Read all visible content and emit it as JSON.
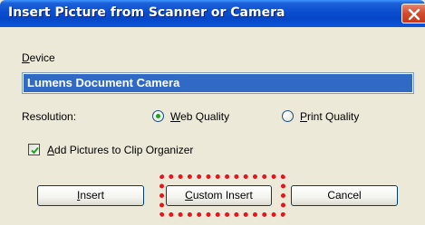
{
  "dialog": {
    "title": "Insert Picture from Scanner or Camera",
    "close_icon": "close-x-icon"
  },
  "device": {
    "label_first": "D",
    "label_rest": "evice",
    "selected": "Lumens Document Camera"
  },
  "resolution": {
    "label": "Resolution:",
    "options": [
      {
        "accel": "W",
        "rest": "eb Quality",
        "selected": true
      },
      {
        "accel": "P",
        "rest": "rint Quality",
        "selected": false
      }
    ]
  },
  "clip_organizer": {
    "accel": "A",
    "rest": "dd Pictures to Clip Organizer",
    "checked": true
  },
  "buttons": {
    "insert": {
      "accel": "I",
      "rest": "nsert"
    },
    "custom_insert": {
      "accel": "C",
      "rest": "ustom Insert"
    },
    "cancel": {
      "label": "Cancel"
    }
  },
  "annotation": {
    "color": "#e8141b"
  },
  "colors": {
    "title_bar": "#0a4ed0",
    "selection": "#316ac5",
    "dialog_bg": "#ece9d8"
  }
}
